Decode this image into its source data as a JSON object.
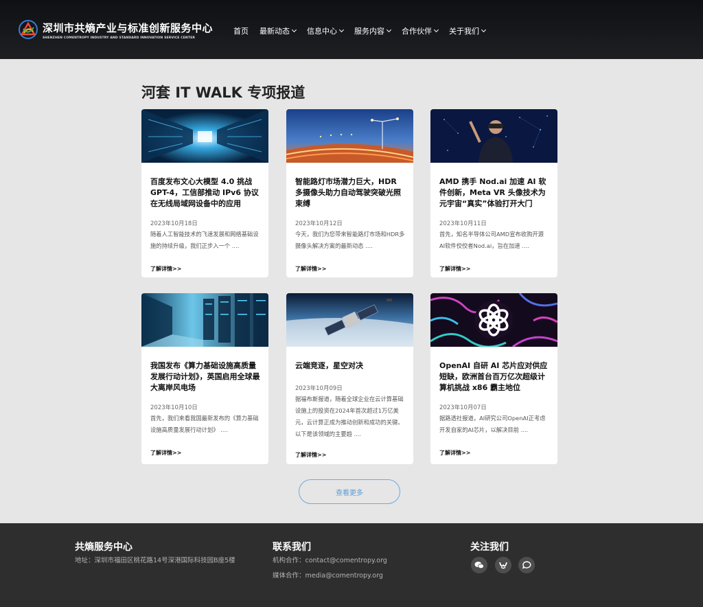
{
  "header": {
    "brand_cn": "深圳市共熵产业与标准创新服务中心",
    "brand_en": "SHENZHEN COMENTROPY INDUSTRY AND STANDARD INNOVATION SERVICE CENTER",
    "nav": [
      {
        "label": "首页",
        "dropdown": false
      },
      {
        "label": "最新动态",
        "dropdown": true
      },
      {
        "label": "信息中心",
        "dropdown": true
      },
      {
        "label": "服务内容",
        "dropdown": true
      },
      {
        "label": "合作伙伴",
        "dropdown": true
      },
      {
        "label": "关于我们",
        "dropdown": true
      }
    ]
  },
  "main": {
    "section_title": "河套 IT WALK 专项报道",
    "more_label": "了解详情>>",
    "cards": [
      {
        "title": "百度发布文心大模型 4.0 挑战 GPT-4，工信部推动 IPv6 协议在无线局域网设备中的应用",
        "date": "2023年10月18日",
        "excerpt": "随着人工智能技术的飞速发展和网络基础设施的持续升级，我们正步入一个 ....",
        "image": "server-corridor-image"
      },
      {
        "title": "智能路灯市场潜力巨大，HDR 多摄像头助力自动驾驶突破光照束缚",
        "date": "2023年10月12日",
        "excerpt": "今天，我们为您带来智能路灯市场和HDR多摄像头解决方案的最新动态 ....",
        "image": "street-lights-image"
      },
      {
        "title": "AMD 携手 Nod.ai 加速 AI 软件创新，Meta VR 头像技术为元宇宙“真实”体验打开大门",
        "date": "2023年10月11日",
        "excerpt": "首先，知名半导体公司AMD宣布收购开源AI软件佼佼者Nod.ai，旨在加速 ....",
        "image": "vr-person-image"
      },
      {
        "title": "我国发布《算力基础设施高质量发展行动计划》，英国启用全球最大离岸风电场",
        "date": "2023年10月10日",
        "excerpt": "首先，我们来看我国最新发布的《算力基础设施高质量发展行动计划》 ....",
        "image": "data-center-image"
      },
      {
        "title": "云端竞逐，星空对决",
        "date": "2023年10月09日",
        "excerpt": "据福布斯报道，随着全球企业在云计算基础设施上的投资在2024年首次超过1万亿美元，云计算正成为推动创新和成功的关键。以下是该领域的主要趋 ....",
        "image": "satellite-image"
      },
      {
        "title": "OpenAI 自研 AI 芯片应对供应短缺，欧洲首台百万亿次超级计算机挑战 x86 霸主地位",
        "date": "2023年10月07日",
        "excerpt": "据路透社报道，AI研究公司OpenAI正考虑开发自家的AI芯片，以解决目前 ....",
        "image": "openai-logo-image"
      }
    ],
    "load_more": "查看更多"
  },
  "footer": {
    "col1_title": "共熵服务中心",
    "address": "地址：深圳市福田区桃花路14号深港国际科技园B座5楼",
    "col2_title": "联系我们",
    "contact1": "机构合作：contact@comentropy.org",
    "contact2": "媒体合作：media@comentropy.org",
    "col3_title": "关注我们",
    "social": [
      "wechat-icon",
      "weibo-icon",
      "chat-icon"
    ]
  }
}
